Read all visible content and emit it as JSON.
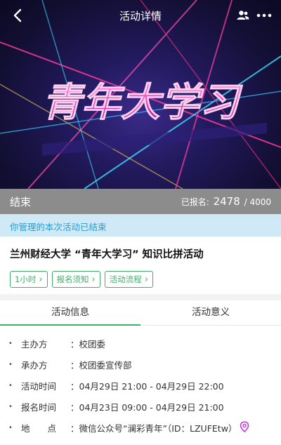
{
  "header": {
    "title": "活动详情"
  },
  "banner": {
    "title_art": "青年大学习"
  },
  "status": {
    "label": "结束",
    "registered_prefix": "已报名:",
    "registered_count": "2478",
    "registered_sep": "/",
    "capacity": "4000"
  },
  "notice": {
    "text": "你管理的本次活动已结束"
  },
  "activity": {
    "title": "兰州财经大学 “青年大学习” 知识比拼活动",
    "tags": [
      "1小时",
      "报名须知",
      "活动流程"
    ]
  },
  "tabs": [
    "活动信息",
    "活动意义"
  ],
  "details": [
    {
      "key": "主办方",
      "sep": "：",
      "value": "校团委"
    },
    {
      "key": "承办方",
      "sep": "：",
      "value": "校团委宣传部"
    },
    {
      "key": "活动时间",
      "sep": "：",
      "value": "04月29日 21:00 - 04月29日 22:00"
    },
    {
      "key": "报名时间",
      "sep": "：",
      "value": "04月23日 09:00 - 04月29日 21:00"
    },
    {
      "key": "地　　点",
      "sep": "：",
      "value": "微信公众号“澜彩青年”（ID：LZUFEtw）"
    }
  ],
  "colors": {
    "accent": "#3fae6a",
    "status_bar": "#8c8c8c",
    "notice_bg": "#cfeaf6",
    "notice_text": "#2e9ad0",
    "location_icon": "#c23bd4"
  },
  "icons": {
    "back": "chevron-left-icon",
    "people": "people-icon",
    "more": "more-icon",
    "location": "map-pin-icon"
  }
}
